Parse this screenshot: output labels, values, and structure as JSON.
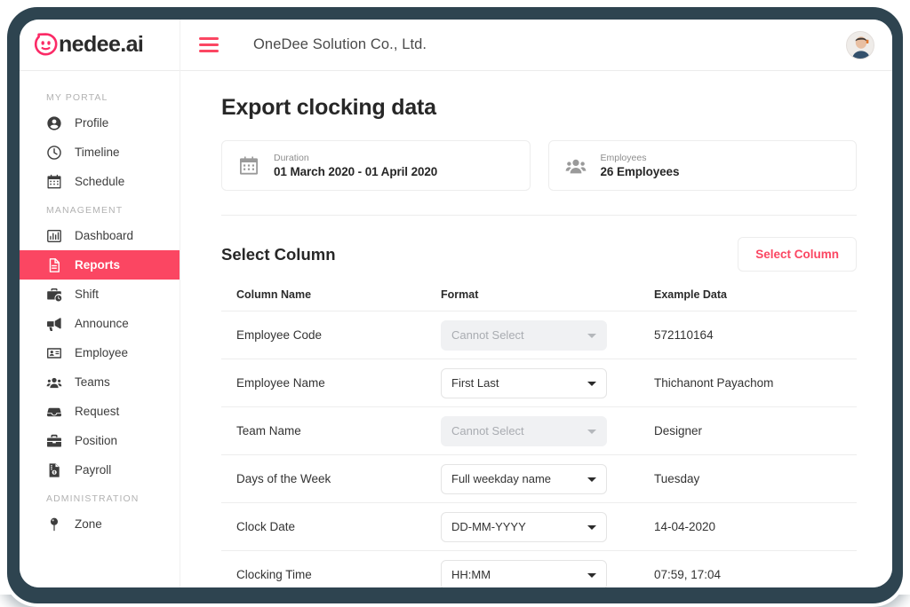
{
  "brand": {
    "logo_text": "nedee.ai",
    "accent_color": "#FB4662",
    "frame_color": "#2E4450"
  },
  "topbar": {
    "menu_icon": "hamburger-icon",
    "company_title": "OneDee Solution Co., Ltd.",
    "avatar": "user-avatar"
  },
  "sidebar": {
    "groups": [
      {
        "label": "MY PORTAL",
        "items": [
          {
            "label": "Profile",
            "icon": "user-circle-icon",
            "active": false
          },
          {
            "label": "Timeline",
            "icon": "clock-icon",
            "active": false
          },
          {
            "label": "Schedule",
            "icon": "calendar-icon",
            "active": false
          }
        ]
      },
      {
        "label": "MANAGEMENT",
        "items": [
          {
            "label": "Dashboard",
            "icon": "bar-chart-icon",
            "active": false
          },
          {
            "label": "Reports",
            "icon": "document-icon",
            "active": true
          },
          {
            "label": "Shift",
            "icon": "briefcase-clock-icon",
            "active": false
          },
          {
            "label": "Announce",
            "icon": "megaphone-icon",
            "active": false
          },
          {
            "label": "Employee",
            "icon": "id-card-icon",
            "active": false
          },
          {
            "label": "Teams",
            "icon": "people-group-icon",
            "active": false
          },
          {
            "label": "Request",
            "icon": "inbox-icon",
            "active": false
          },
          {
            "label": "Position",
            "icon": "briefcase-icon",
            "active": false
          },
          {
            "label": "Payroll",
            "icon": "payroll-doc-icon",
            "active": false
          }
        ]
      },
      {
        "label": "ADMINISTRATION",
        "items": [
          {
            "label": "Zone",
            "icon": "map-pin-icon",
            "active": false
          }
        ]
      }
    ]
  },
  "main": {
    "page_title": "Export clocking data",
    "cards": [
      {
        "icon": "calendar-icon",
        "label": "Duration",
        "value": "01 March 2020 - 01 April 2020"
      },
      {
        "icon": "people-group-icon",
        "label": "Employees",
        "value": "26 Employees"
      }
    ],
    "section": {
      "title": "Select Column",
      "button_label": "Select Column"
    },
    "table": {
      "headers": {
        "column_name": "Column Name",
        "format": "Format",
        "example_data": "Example Data"
      },
      "rows": [
        {
          "name": "Employee Code",
          "format": "Cannot Select",
          "enabled": false,
          "example": "572110164"
        },
        {
          "name": "Employee Name",
          "format": "First Last",
          "enabled": true,
          "example": "Thichanont Payachom"
        },
        {
          "name": "Team Name",
          "format": "Cannot Select",
          "enabled": false,
          "example": "Designer"
        },
        {
          "name": "Days of the Week",
          "format": "Full weekday name",
          "enabled": true,
          "example": "Tuesday"
        },
        {
          "name": "Clock Date",
          "format": "DD-MM-YYYY",
          "enabled": true,
          "example": "14-04-2020"
        },
        {
          "name": "Clocking Time",
          "format": "HH:MM",
          "enabled": true,
          "example": "07:59, 17:04"
        }
      ]
    }
  }
}
